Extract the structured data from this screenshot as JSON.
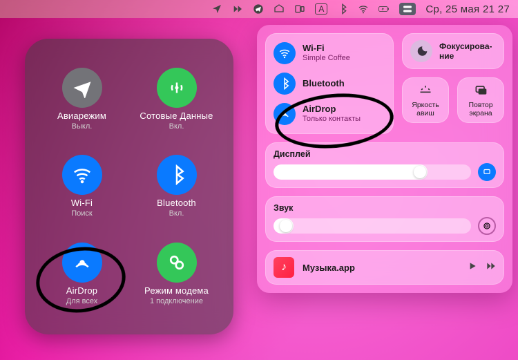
{
  "menubar": {
    "date_text": "Ср, 25 мая  21 27",
    "lang_indicator": "A"
  },
  "ios": {
    "items": [
      {
        "title": "Авиарежим",
        "sub": "Выкл."
      },
      {
        "title": "Сотовые Данные",
        "sub": "Вкл."
      },
      {
        "title": "Wi-Fi",
        "sub": "Поиск"
      },
      {
        "title": "Bluetooth",
        "sub": "Вкл."
      },
      {
        "title": "AirDrop",
        "sub": "Для всех"
      },
      {
        "title": "Режим модема",
        "sub": "1 подключение"
      }
    ]
  },
  "cc": {
    "conn": {
      "wifi": {
        "title": "Wi-Fi",
        "sub": "Simple Coffee"
      },
      "bluetooth": {
        "title": "Bluetooth",
        "sub": ""
      },
      "airdrop": {
        "title": "AirDrop",
        "sub": "Только контакты"
      }
    },
    "focus_label": "Фокусирова-\nние",
    "keyboard_brightness": "Яркость\nавиш",
    "screen_mirroring": "Повтор\nэкрана",
    "display_label": "Дисплей",
    "display_value_pct": 78,
    "sound_label": "Звук",
    "sound_value_pct": 10,
    "music_title": "Музыка.app"
  }
}
